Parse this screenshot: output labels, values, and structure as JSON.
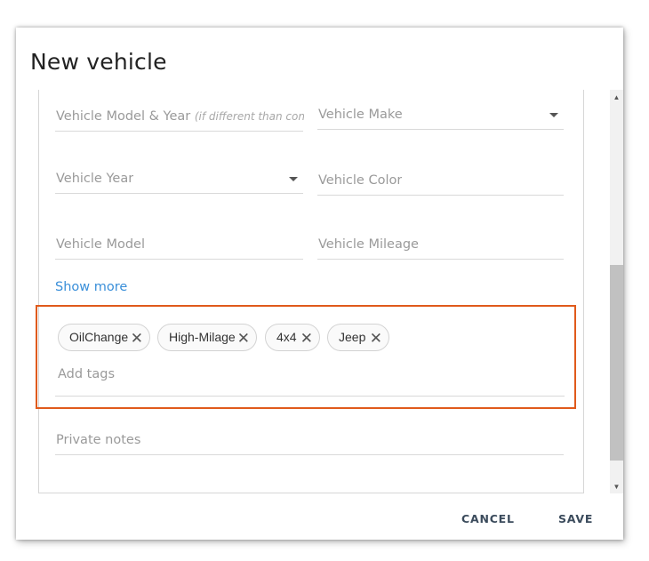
{
  "dialog": {
    "title": "New vehicle",
    "fields": {
      "model_year": {
        "placeholder": "Vehicle Model & Year",
        "hint": "(if different than contac..."
      },
      "make": {
        "placeholder": "Vehicle Make"
      },
      "year": {
        "placeholder": "Vehicle Year"
      },
      "color": {
        "placeholder": "Vehicle Color"
      },
      "model": {
        "placeholder": "Vehicle Model"
      },
      "mileage": {
        "placeholder": "Vehicle Mileage"
      },
      "private_notes": {
        "placeholder": "Private notes"
      }
    },
    "show_more": "Show more",
    "tags": {
      "items": [
        "OilChange",
        "High-Milage",
        "4x4",
        "Jeep"
      ],
      "placeholder": "Add tags"
    },
    "actions": {
      "cancel": "CANCEL",
      "save": "SAVE"
    },
    "icons": {
      "remove_tag": "close-icon",
      "dropdown": "chevron-down-icon"
    },
    "colors": {
      "accent_link": "#3a8fd9",
      "highlight_border": "#e05a1b",
      "button_text": "#3b4b5c"
    }
  }
}
